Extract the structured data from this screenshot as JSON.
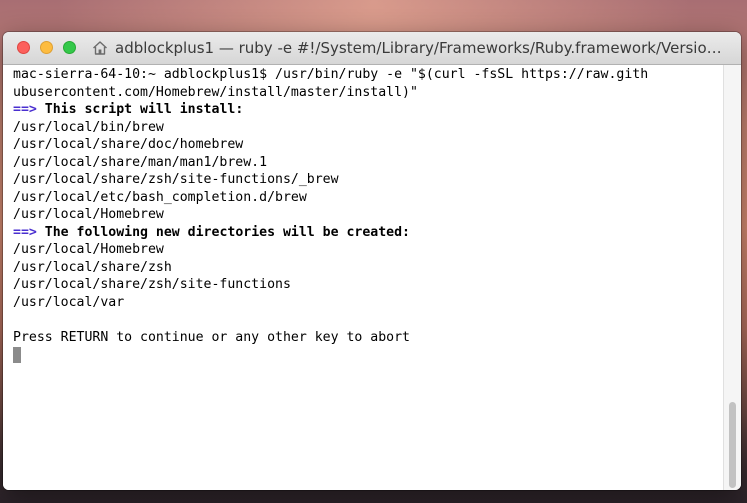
{
  "window": {
    "title": "adblockplus1 — ruby -e #!/System/Library/Frameworks/Ruby.framework/Versions..."
  },
  "icons": {
    "close": "close-button",
    "minimize": "minimize-button",
    "zoom": "zoom-button",
    "title": "home-icon"
  },
  "colors": {
    "arrow": "#4a2fd0",
    "text": "#000000",
    "close": "#fc605c",
    "minimize": "#fdbc40",
    "zoom": "#34c84a"
  },
  "terminal": {
    "lines": [
      {
        "text": "mac-sierra-64-10:~ adblockplus1$ /usr/bin/ruby -e \"$(curl -fsSL https://raw.gith"
      },
      {
        "text": "ubusercontent.com/Homebrew/install/master/install)\""
      },
      {
        "arrow": "==>",
        "text": " This script will install:"
      },
      {
        "text": "/usr/local/bin/brew"
      },
      {
        "text": "/usr/local/share/doc/homebrew"
      },
      {
        "text": "/usr/local/share/man/man1/brew.1"
      },
      {
        "text": "/usr/local/share/zsh/site-functions/_brew"
      },
      {
        "text": "/usr/local/etc/bash_completion.d/brew"
      },
      {
        "text": "/usr/local/Homebrew"
      },
      {
        "arrow": "==>",
        "text": " The following new directories will be created:"
      },
      {
        "text": "/usr/local/Homebrew"
      },
      {
        "text": "/usr/local/share/zsh"
      },
      {
        "text": "/usr/local/share/zsh/site-functions"
      },
      {
        "text": "/usr/local/var"
      },
      {
        "text": ""
      },
      {
        "text": "Press RETURN to continue or any other key to abort"
      }
    ]
  }
}
